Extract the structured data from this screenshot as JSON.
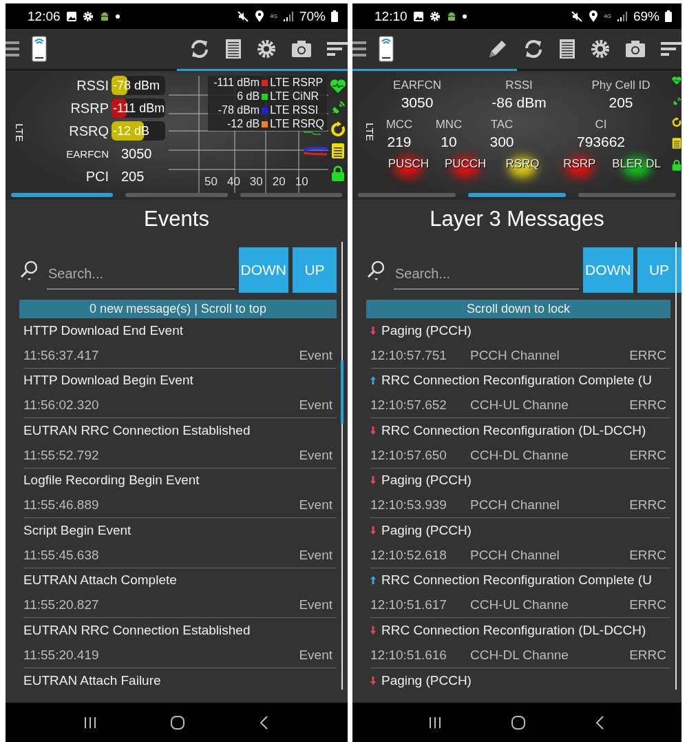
{
  "screens": [
    {
      "status_bar": {
        "time": "12:06",
        "network_type": "4G",
        "battery": "70%"
      },
      "top_pager": [
        {
          "selected": false
        },
        {
          "selected": true
        }
      ],
      "panel": {
        "kind": "signal",
        "network_label": "LTE",
        "gauges": [
          {
            "label": "RSSI",
            "reading": "-78 dBm",
            "level": 0.3,
            "color": "#c9b800"
          },
          {
            "label": "RSRP",
            "reading": "-111 dBm",
            "level": 0.28,
            "color": "#c41010"
          },
          {
            "label": "RSRQ",
            "reading": "-12 dB",
            "level": 0.6,
            "color": "#c9b800"
          }
        ],
        "fields": [
          {
            "label": "EARFCN",
            "value": "3050"
          },
          {
            "label": "PCI",
            "value": "205"
          }
        ],
        "legend": [
          {
            "value": "-111 dBm",
            "label": "LTE RSRP",
            "color": "#e02020"
          },
          {
            "value": "6 dB",
            "label": "LTE CiNR",
            "color": "#20d020"
          },
          {
            "value": "-78 dBm",
            "label": "LTE RSSI",
            "color": "#2020e0"
          },
          {
            "value": "-12 dB",
            "label": "LTE RSRQ",
            "color": "#f08020"
          }
        ],
        "x_tick_labels": [
          "50",
          "40",
          "30",
          "20",
          "10"
        ]
      },
      "page_tabs": [
        {
          "selected": true
        },
        {
          "selected": false
        },
        {
          "selected": false
        }
      ],
      "title": "Events",
      "search": {
        "placeholder": "Search..."
      },
      "buttons": [
        "DOWN",
        "UP"
      ],
      "banner": "0 new message(s) | Scroll to top",
      "list": {
        "kind": "events",
        "rows": [
          {
            "name": "HTTP Download End Event",
            "time": "11:56:37.417",
            "type": "Event"
          },
          {
            "name": "HTTP Download Begin Event",
            "time": "11:56:02.320",
            "type": "Event"
          },
          {
            "name": "EUTRAN RRC Connection Established",
            "time": "11:55:52.792",
            "type": "Event"
          },
          {
            "name": "Logfile Recording Begin Event",
            "time": "11:55:46.889",
            "type": "Event"
          },
          {
            "name": "Script Begin Event",
            "time": "11:55:45.638",
            "type": "Event"
          },
          {
            "name": "EUTRAN Attach Complete",
            "time": "11:55:20.827",
            "type": "Event"
          },
          {
            "name": "EUTRAN RRC Connection Established",
            "time": "11:55:20.419",
            "type": "Event"
          },
          {
            "name": "EUTRAN Attach Failure"
          }
        ]
      }
    },
    {
      "status_bar": {
        "time": "12:10",
        "network_type": "4G",
        "battery": "69%"
      },
      "top_pager": [
        {
          "selected": true
        },
        {
          "selected": false
        }
      ],
      "panel": {
        "kind": "cell",
        "network_label": "LTE",
        "cell_info": [
          {
            "label": "EARFCN",
            "value": "3050"
          },
          {
            "label": "RSSI",
            "value": "-86 dBm"
          },
          {
            "label": "Phy Cell ID",
            "value": "205"
          }
        ],
        "cell_ids": [
          {
            "label": "MCC",
            "value": "219"
          },
          {
            "label": "MNC",
            "value": "10"
          },
          {
            "label": "TAC",
            "value": "300"
          },
          {
            "label": "CI",
            "value": "793662"
          }
        ],
        "indicators": [
          {
            "label": "PUSCH",
            "color": "#e01010"
          },
          {
            "label": "PUCCH",
            "color": "#e01010"
          },
          {
            "label": "RSRQ",
            "color": "#e0d010"
          },
          {
            "label": "RSRP",
            "color": "#e01010"
          },
          {
            "label": "BLER DL",
            "color": "#10c020"
          }
        ]
      },
      "page_tabs": [
        {
          "selected": false
        },
        {
          "selected": true
        },
        {
          "selected": false
        }
      ],
      "title": "Layer 3 Messages",
      "search": {
        "placeholder": "Search..."
      },
      "buttons": [
        "DOWN",
        "UP"
      ],
      "banner": "Scroll down to lock",
      "list": {
        "kind": "messages",
        "rows": [
          {
            "uplink": false,
            "name": "Paging (PCCH)",
            "time": "12:10:57.751",
            "channel": "PCCH Channel",
            "protocol": "ERRC"
          },
          {
            "uplink": true,
            "name": "RRC Connection Reconfiguration Complete (U",
            "time": "12:10:57.652",
            "channel": "CCH-UL Channe",
            "protocol": "ERRC"
          },
          {
            "uplink": false,
            "name": "RRC Connection Reconfiguration (DL-DCCH)",
            "time": "12:10:57.650",
            "channel": "CCH-DL Channe",
            "protocol": "ERRC"
          },
          {
            "uplink": false,
            "name": "Paging (PCCH)",
            "time": "12:10:53.939",
            "channel": "PCCH Channel",
            "protocol": "ERRC"
          },
          {
            "uplink": false,
            "name": "Paging (PCCH)",
            "time": "12:10:52.618",
            "channel": "PCCH Channel",
            "protocol": "ERRC"
          },
          {
            "uplink": true,
            "name": "RRC Connection Reconfiguration Complete (U",
            "time": "12:10:51.617",
            "channel": "CCH-UL Channe",
            "protocol": "ERRC"
          },
          {
            "uplink": false,
            "name": "RRC Connection Reconfiguration (DL-DCCH)",
            "time": "12:10:51.616",
            "channel": "CCH-DL Channe",
            "protocol": "ERRC"
          },
          {
            "uplink": false,
            "name": "Paging (PCCH)"
          }
        ]
      }
    }
  ]
}
